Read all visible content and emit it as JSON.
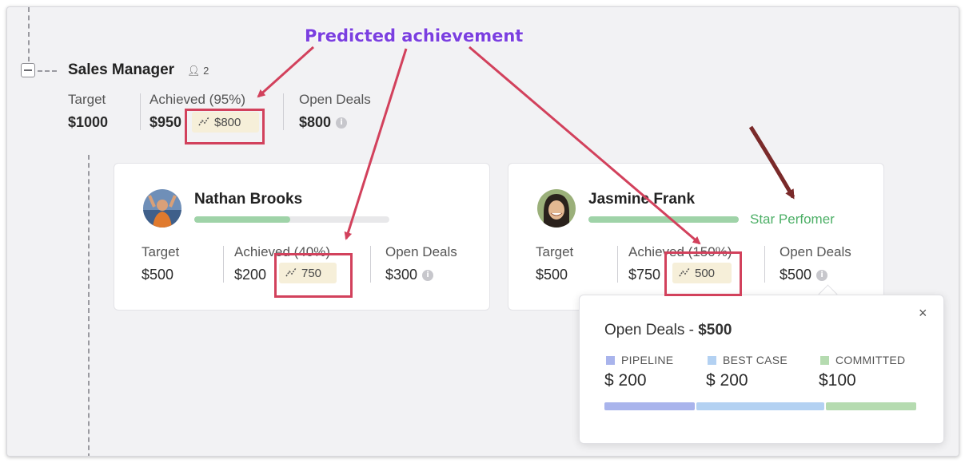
{
  "annotation": {
    "title": "Predicted achievement"
  },
  "manager": {
    "title": "Sales Manager",
    "member_count": "2",
    "target_label": "Target",
    "target_value": "$1000",
    "achieved_label": "Achieved (95%)",
    "achieved_value": "$950",
    "predicted_value": "$800",
    "open_label": "Open Deals",
    "open_value": "$800"
  },
  "members": [
    {
      "name": "Nathan Brooks",
      "progress": 0.49,
      "target_label": "Target",
      "target_value": "$500",
      "achieved_label": "Achieved (40%)",
      "achieved_value": "$200",
      "predicted_value": "750",
      "open_label": "Open Deals",
      "open_value": "$300"
    },
    {
      "name": "Jasmine Frank",
      "progress": 1.0,
      "badge": "Star Perfomer",
      "target_label": "Target",
      "target_value": "$500",
      "achieved_label": "Achieved (150%)",
      "achieved_value": "$750",
      "predicted_value": "500",
      "open_label": "Open Deals",
      "open_value": "$500"
    }
  ],
  "popup": {
    "title_prefix": "Open Deals - ",
    "title_value": "$500",
    "close": "×",
    "segments": [
      {
        "label": "PIPELINE",
        "value": "$ 200",
        "color": "#a9b4ec"
      },
      {
        "label": "BEST CASE",
        "value": "$ 200",
        "color": "#b3d1f2"
      },
      {
        "label": "COMMITTED",
        "value": "$100",
        "color": "#b5dbb0"
      }
    ]
  },
  "colors": {
    "accent_green": "#4caf66",
    "highlight_red": "#d2415c",
    "annotation_purple": "#7b3fe0",
    "arrow_dark_red": "#7a2a2a"
  }
}
